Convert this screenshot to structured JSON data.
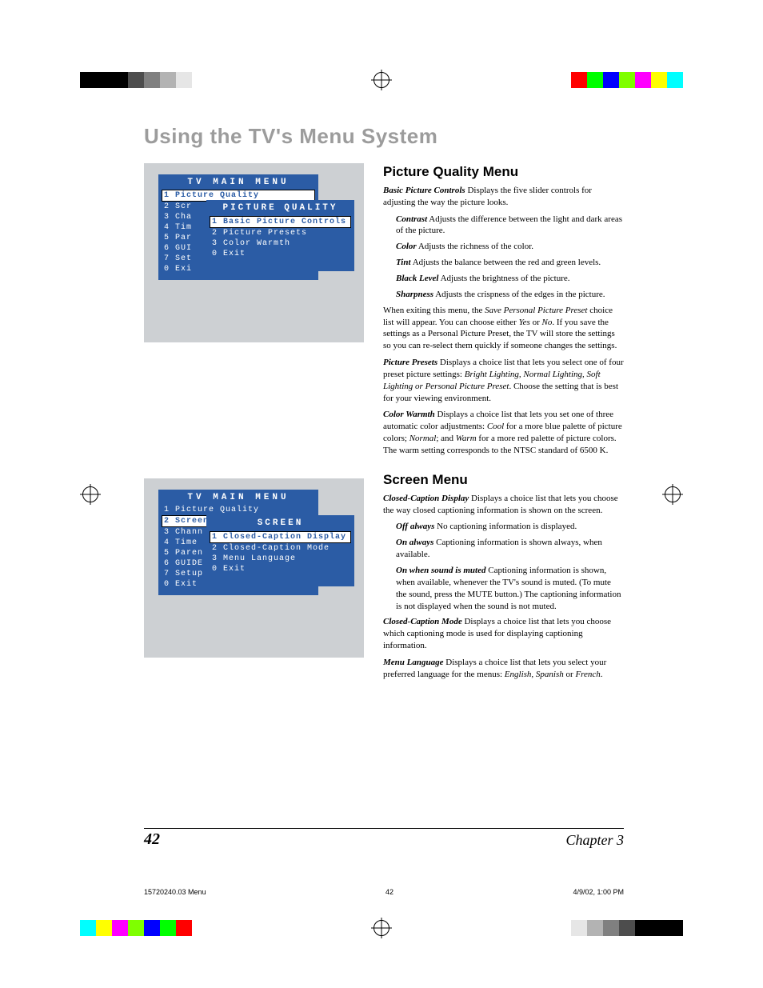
{
  "section_title": "Using the TV's Menu System",
  "tv_menus": {
    "picture_quality": {
      "main_title": "TV MAIN MENU",
      "items": [
        {
          "num": "1",
          "label": "Picture Quality",
          "hl": true
        },
        {
          "num": "2",
          "label": "Scr"
        },
        {
          "num": "3",
          "label": "Cha"
        },
        {
          "num": "4",
          "label": "Tim"
        },
        {
          "num": "5",
          "label": "Par"
        },
        {
          "num": "6",
          "label": "GUI"
        },
        {
          "num": "7",
          "label": "Set"
        },
        {
          "num": "0",
          "label": "Exi"
        }
      ],
      "sub_title": "PICTURE QUALITY",
      "sub_items": [
        {
          "num": "1",
          "label": "Basic Picture Controls",
          "hl": true
        },
        {
          "num": "2",
          "label": "Picture Presets"
        },
        {
          "num": "3",
          "label": "Color Warmth"
        },
        {
          "num": "0",
          "label": "Exit"
        }
      ]
    },
    "screen": {
      "main_title": "TV MAIN MENU",
      "items": [
        {
          "num": "1",
          "label": "Picture Quality"
        },
        {
          "num": "2",
          "label": "Screen",
          "hl": true
        },
        {
          "num": "3",
          "label": "Chann"
        },
        {
          "num": "4",
          "label": "Time"
        },
        {
          "num": "5",
          "label": "Paren"
        },
        {
          "num": "6",
          "label": "GUIDE"
        },
        {
          "num": "7",
          "label": "Setup"
        },
        {
          "num": "0",
          "label": "Exit"
        }
      ],
      "sub_title": "SCREEN",
      "sub_items": [
        {
          "num": "1",
          "label": "Closed-Caption Display",
          "hl": true
        },
        {
          "num": "2",
          "label": "Closed-Caption Mode"
        },
        {
          "num": "3",
          "label": "Menu Language"
        },
        {
          "num": "0",
          "label": "Exit"
        }
      ]
    }
  },
  "text": {
    "pq_heading": "Picture Quality Menu",
    "bpc_term": "Basic Picture Controls",
    "bpc_desc": "    Displays the five slider controls for adjusting the way the picture looks.",
    "contrast_term": "Contrast",
    "contrast_desc": "    Adjusts the difference between the light and dark areas of the picture.",
    "color_term": "Color",
    "color_desc": "    Adjusts the richness of the color.",
    "tint_term": "Tint",
    "tint_desc": "    Adjusts the balance between the red and green levels.",
    "black_term": "Black Level",
    "black_desc": "    Adjusts the brightness of the picture.",
    "sharp_term": "Sharpness",
    "sharp_desc": "    Adjusts the crispness of the edges in the picture.",
    "exit_para_a": "When exiting this menu, the ",
    "exit_para_em": "Save Personal Picture Preset",
    "exit_para_b": " choice list will appear. You can choose either ",
    "exit_para_yes": "Yes",
    "exit_para_c": " or ",
    "exit_para_no": "No",
    "exit_para_d": ". If you save the settings as a Personal Picture Preset, the TV will store the settings so you can re-select them quickly if someone changes the settings.",
    "pp_term": "Picture Presets",
    "pp_desc_a": "    Displays a choice list that lets you select one of four preset picture settings: ",
    "pp_desc_em": "Bright Lighting, Normal Lighting, Soft Lighting or Personal Picture Preset",
    "pp_desc_b": ". Choose the setting that is best for your viewing environment.",
    "cw_term": "Color Warmth",
    "cw_desc_a": "    Displays a choice list that lets you set one of three automatic color adjustments: ",
    "cw_cool": "Cool",
    "cw_desc_b": " for a more blue palette of picture colors; ",
    "cw_normal": "Normal",
    "cw_desc_c": "; and ",
    "cw_warm": "Warm",
    "cw_desc_d": " for a more red palette of picture colors. The warm setting corresponds to the NTSC standard of 6500 K.",
    "sc_heading": "Screen Menu",
    "ccd_term": "Closed-Caption Display",
    "ccd_desc": "    Displays a choice list that lets you choose the way closed captioning information is shown on the screen.",
    "off_term": "Off always",
    "off_desc": "    No captioning information is displayed.",
    "on_term": "On always",
    "on_desc": "    Captioning information is shown always, when available.",
    "mute_term": "On when sound is muted",
    "mute_desc": "    Captioning information is shown, when available, whenever the TV's sound is muted. (To mute the sound, press the MUTE button.) The captioning information is not displayed when the sound is not muted.",
    "ccm_term": "Closed-Caption Mode",
    "ccm_desc": "    Displays a choice list that lets you choose which captioning mode is used for displaying captioning information.",
    "ml_term": "Menu Language",
    "ml_desc_a": "    Displays a choice list that lets you select your preferred language for the menus: ",
    "ml_en": "English",
    "ml_desc_b": ", ",
    "ml_es": "Spanish",
    "ml_desc_c": " or ",
    "ml_fr": "French",
    "ml_desc_d": "."
  },
  "footer": {
    "page_num": "42",
    "chapter": "Chapter 3"
  },
  "slug": {
    "file": "15720240.03 Menu",
    "page": "42",
    "datetime": "4/9/02, 1:00 PM"
  },
  "color_bars": {
    "top_left": [
      "#000000",
      "#000000",
      "#000000",
      "#4d4d4d",
      "#808080",
      "#b3b3b3",
      "#e6e6e6"
    ],
    "top_right": [
      "#ff0000",
      "#00ff00",
      "#0000ff",
      "#7fff00",
      "#ff00ff",
      "#ffff00",
      "#00ffff"
    ],
    "bottom_left": [
      "#00ffff",
      "#ffff00",
      "#ff00ff",
      "#7fff00",
      "#0000ff",
      "#00ff00",
      "#ff0000"
    ],
    "bottom_right": [
      "#e6e6e6",
      "#b3b3b3",
      "#808080",
      "#4d4d4d",
      "#000000",
      "#000000",
      "#000000"
    ]
  }
}
